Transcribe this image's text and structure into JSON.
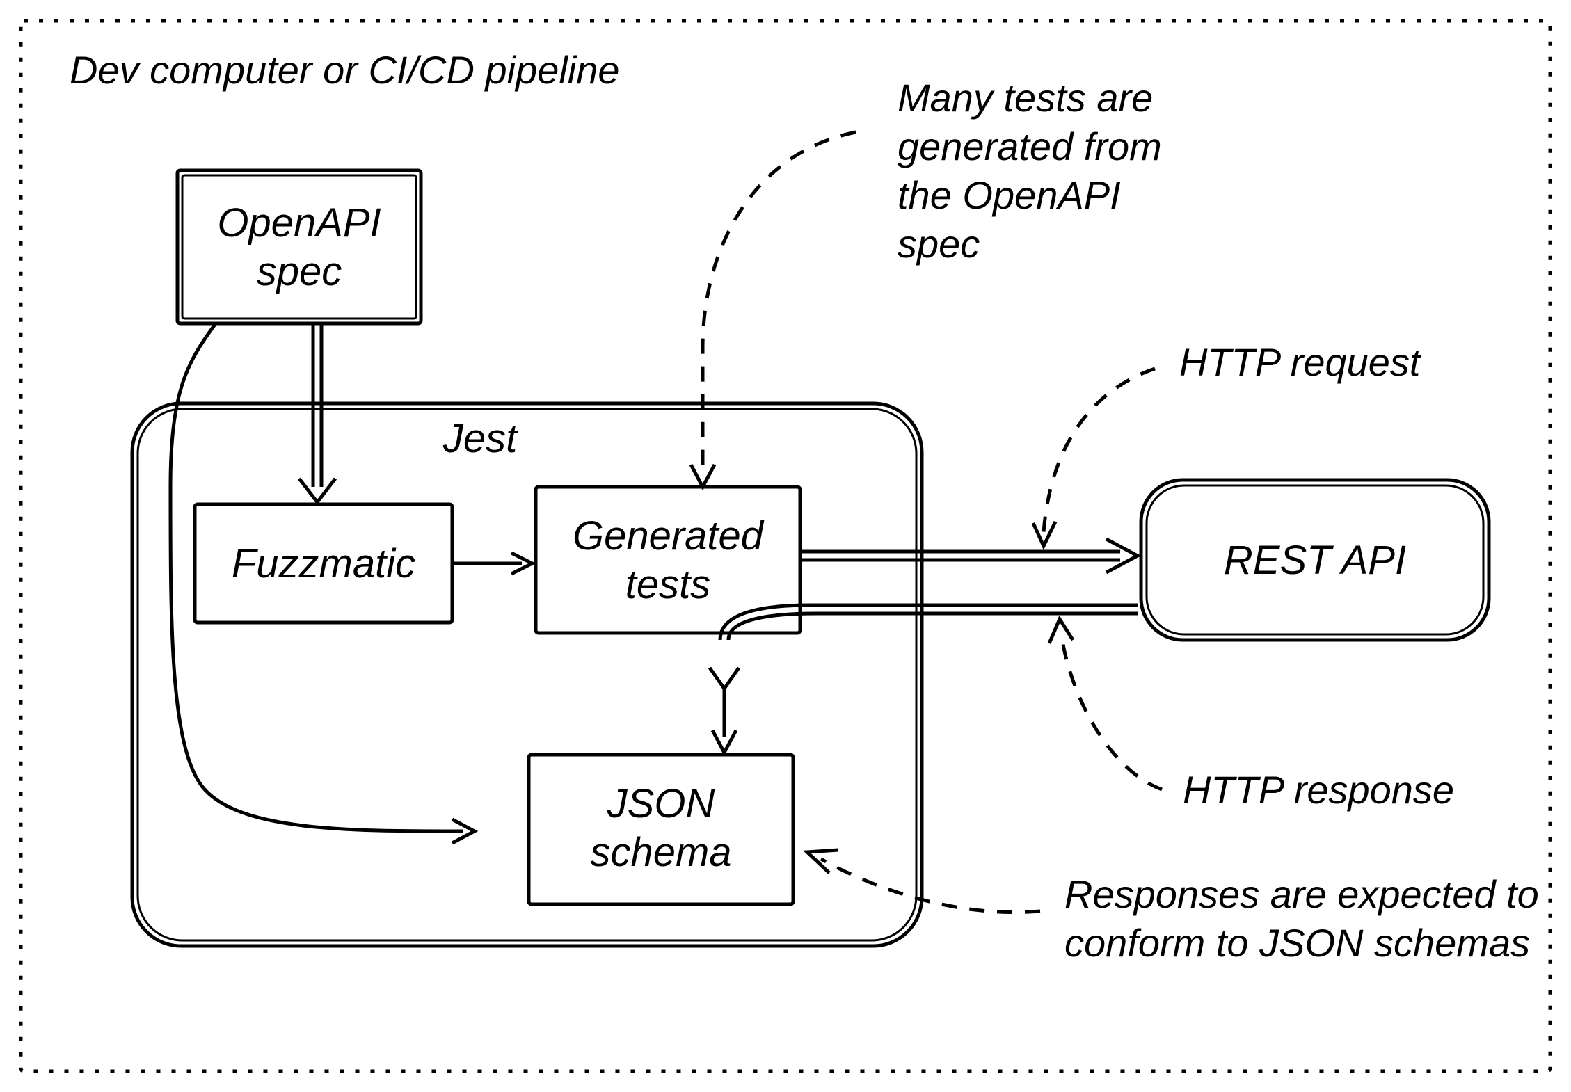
{
  "container_title": "Dev computer or CI/CD pipeline",
  "nodes": {
    "openapi_spec": "OpenAPI\nspec",
    "jest_title": "Jest",
    "fuzzmatic": "Fuzzmatic",
    "generated_tests": "Generated\ntests",
    "json_schema": "JSON\nschema",
    "rest_api": "REST API"
  },
  "annotations": {
    "many_tests": "Many tests are\ngenerated from\nthe OpenAPI\nspec",
    "http_request": "HTTP request",
    "http_response": "HTTP response",
    "responses_conform": "Responses are expected to\nconform to JSON schemas"
  }
}
